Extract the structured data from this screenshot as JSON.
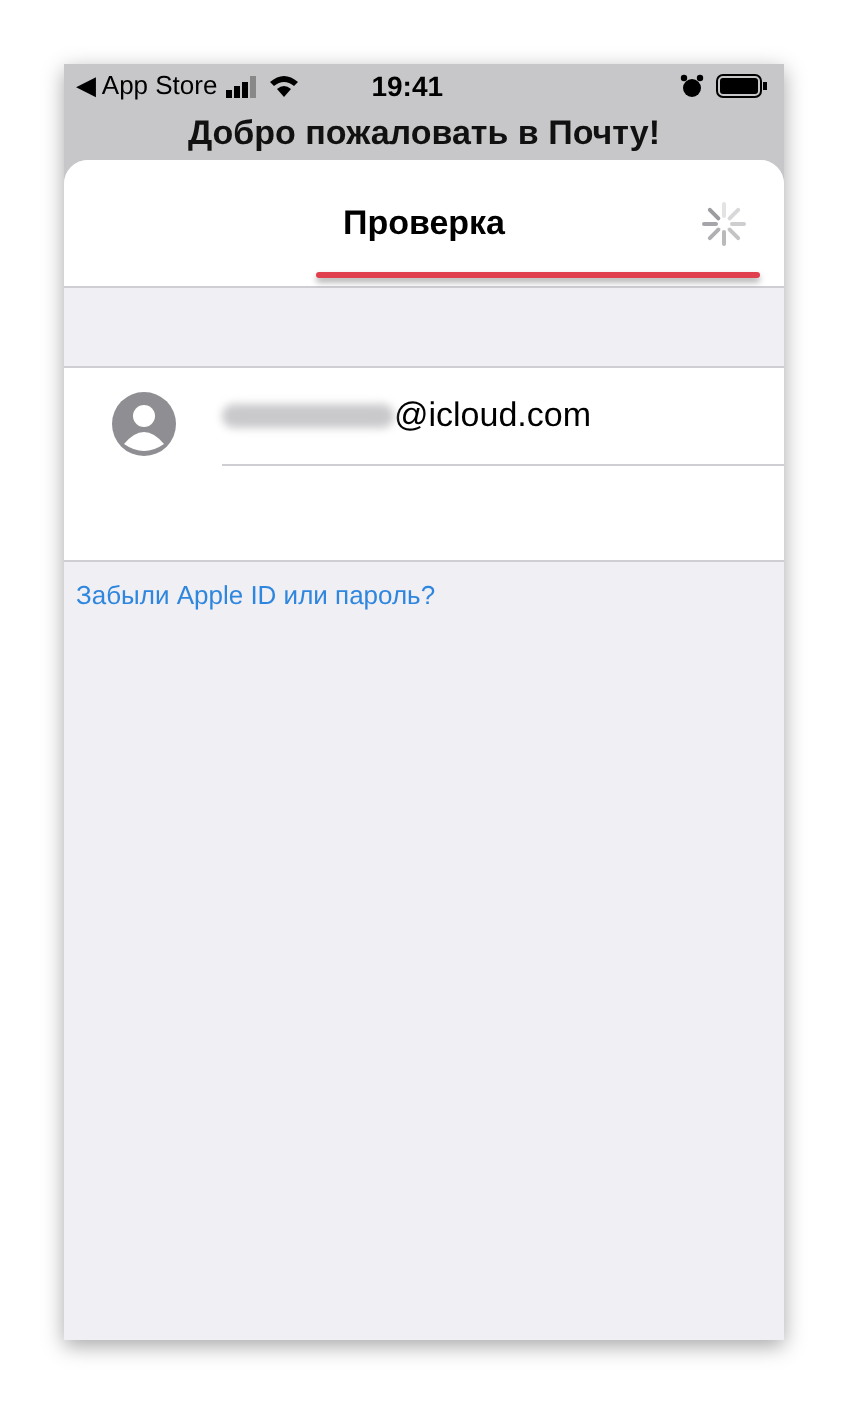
{
  "status_bar": {
    "back_label": "◀ App Store",
    "time": "19:41"
  },
  "background_title": "Добро пожаловать в Почту!",
  "sheet": {
    "title": "Проверка",
    "loading": true
  },
  "account": {
    "email": "@icloud.com"
  },
  "forgot_link": "Забыли Apple ID или пароль?"
}
